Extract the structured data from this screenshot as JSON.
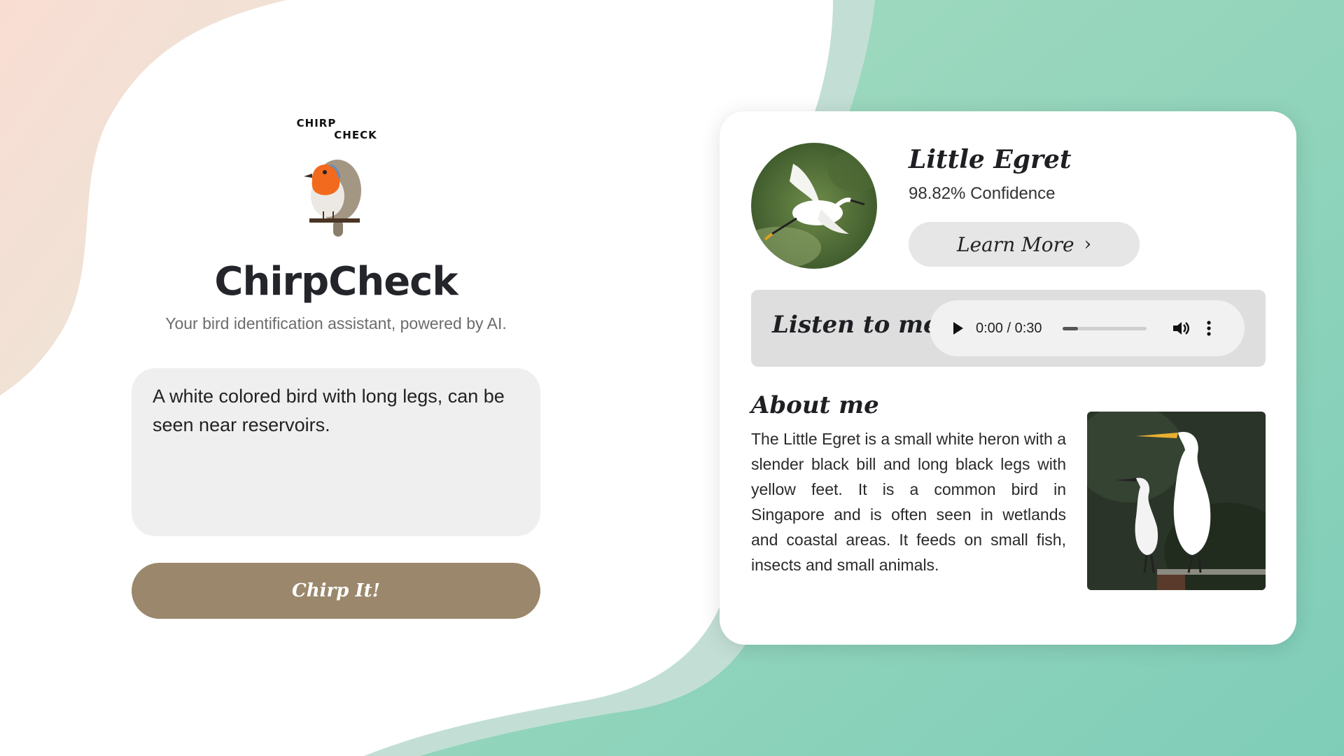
{
  "app": {
    "logo_line1": "CHIRP",
    "logo_line2": "CHECK",
    "title": "ChirpCheck",
    "subtitle": "Your bird identification assistant, powered by AI."
  },
  "input": {
    "description": "A white colored bird with long legs, can be seen near reservoirs.",
    "submit_label": "Chirp It!"
  },
  "result": {
    "bird_name": "Little Egret",
    "confidence": "98.82% Confidence",
    "learn_more_label": "Learn More",
    "listen_label": "Listen to me",
    "audio": {
      "time": "0:00 / 0:30",
      "progress_fraction": 0.18
    },
    "about_title": "About me",
    "about_text": "The Little Egret is a small white heron with a slender black bill and long black legs with yellow feet. It is a common bird in Singapore and is often seen in wetlands and coastal areas. It feeds on small fish, insects and small animals."
  },
  "icons": {
    "play": "play-icon",
    "volume": "volume-icon",
    "more": "more-vertical-icon",
    "chevron": "chevron-right-icon"
  },
  "colors": {
    "button_brown": "#9b876b",
    "robin_orange": "#f26a1d",
    "bg_green": "#8fd0b5",
    "bg_peach": "#f7ddd2"
  }
}
